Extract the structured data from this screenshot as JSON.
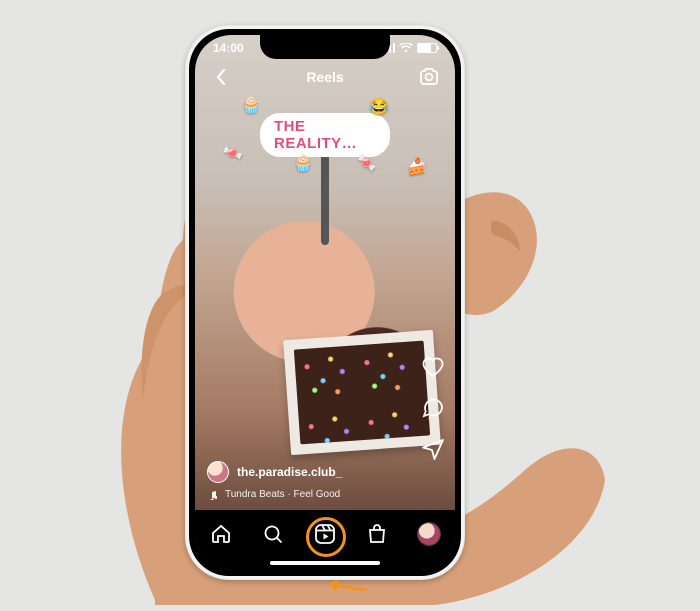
{
  "status_bar": {
    "time": "14:00"
  },
  "header": {
    "title": "Reels"
  },
  "overlay": {
    "caption": "THE REALITY…",
    "emoji": [
      "🧁",
      "😂",
      "🍬",
      "🧁",
      "🍬",
      "🍰"
    ]
  },
  "actions": {
    "like_label": "",
    "comment_label": "",
    "share_label": ""
  },
  "post": {
    "username": "the.paradise.club_",
    "audio": "Tundra Beats · Feel Good"
  },
  "nav": {
    "items": [
      "home",
      "search",
      "reels",
      "shop",
      "profile"
    ],
    "active": "reels"
  },
  "callout": {
    "target": "reels-tab"
  }
}
